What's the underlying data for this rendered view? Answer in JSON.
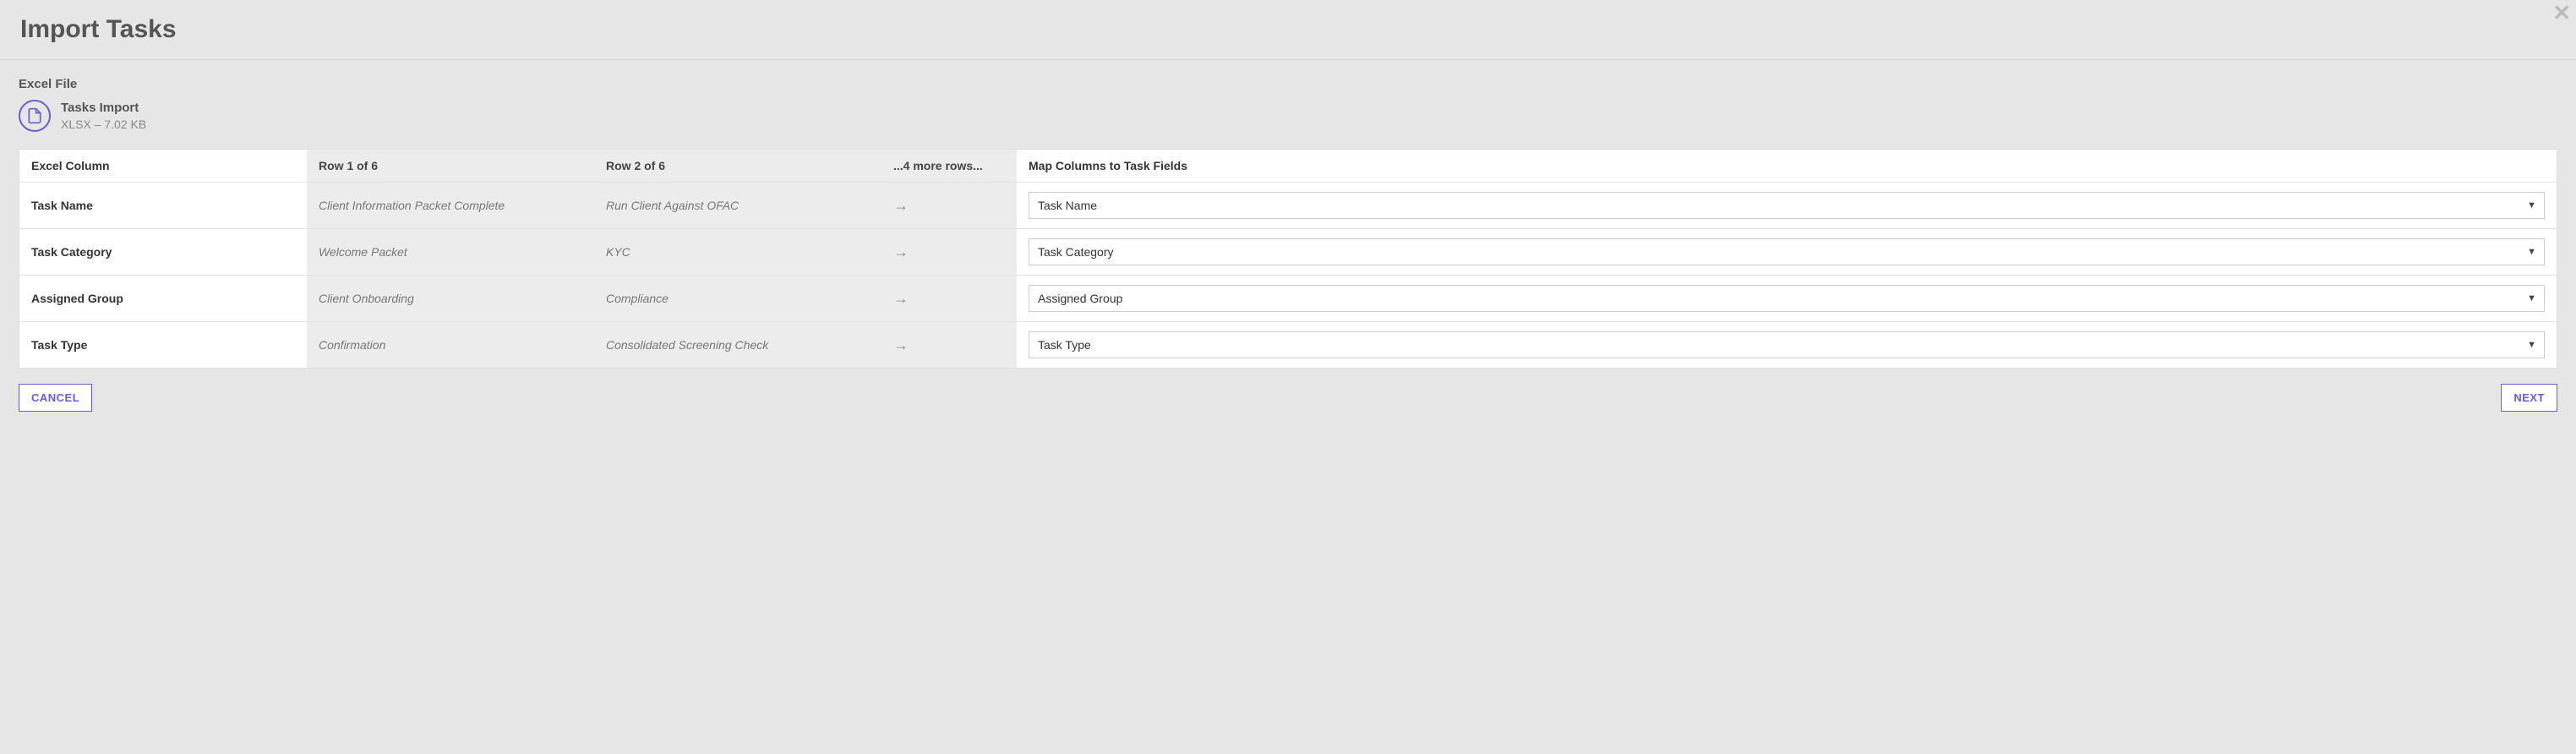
{
  "header": {
    "title": "Import Tasks"
  },
  "file": {
    "section_label": "Excel File",
    "name": "Tasks Import",
    "detail": "XLSX – 7.02 KB"
  },
  "table": {
    "headers": {
      "excel_column": "Excel Column",
      "row1": "Row 1 of 6",
      "row2": "Row 2 of 6",
      "more": "...4 more rows...",
      "map": "Map Columns to Task Fields"
    },
    "rows": [
      {
        "excel": "Task Name",
        "row1": "Client Information Packet Complete",
        "row2": "Run Client Against OFAC",
        "map_value": "Task Name"
      },
      {
        "excel": "Task Category",
        "row1": "Welcome Packet",
        "row2": "KYC",
        "map_value": "Task Category"
      },
      {
        "excel": "Assigned Group",
        "row1": "Client Onboarding",
        "row2": "Compliance",
        "map_value": "Assigned Group"
      },
      {
        "excel": "Task Type",
        "row1": "Confirmation",
        "row2": "Consolidated Screening Check",
        "map_value": "Task Type"
      }
    ]
  },
  "footer": {
    "cancel": "CANCEL",
    "next": "NEXT"
  }
}
